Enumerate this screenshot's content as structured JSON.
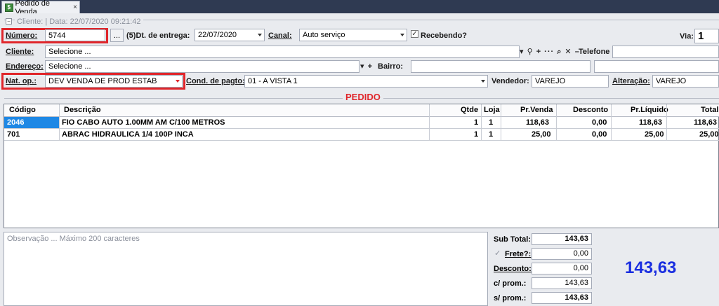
{
  "tab": {
    "label": "Pedido de Venda",
    "close": "×"
  },
  "header": {
    "cliente_group": "Cliente:  | Data: 22/07/2020 09:21:42"
  },
  "form": {
    "numero_label": "Número:",
    "numero_value": "5744",
    "ellipsis": "...",
    "dt_entrega_label": "(5)Dt. de entrega:",
    "dt_entrega_value": "22/07/2020",
    "canal_label": "Canal:",
    "canal_value": "Auto serviço",
    "recebendo_label": "Recebendo?",
    "recebendo_check": "✓",
    "via_label": "Via:",
    "via_value": "1",
    "cliente_label": "Cliente:",
    "cliente_value": "Selecione ...",
    "cliente_icons": "▾ ⚲ + ··· ⌕ ✕ –",
    "telefone_label": "Telefone",
    "endereco_label": "Endereço:",
    "endereco_value": "Selecione ...",
    "endereco_icons": "▾ +",
    "bairro_label": "Bairro:",
    "natop_label": "Nat. op.:",
    "natop_value": "DEV VENDA DE PROD ESTAB",
    "cond_label": "Cond. de pagto:",
    "cond_value": "01 - A VISTA 1",
    "vendedor_label": "Vendedor:",
    "vendedor_value": "VAREJO",
    "alteracao_label": "Alteração:",
    "alteracao_value": "VAREJO"
  },
  "pedido_title": "PEDIDO",
  "grid": {
    "headers": [
      "Código",
      "Descrição",
      "Qtde",
      "Loja",
      "Pr.Venda",
      "Desconto",
      "Pr.Líquido",
      "Total"
    ],
    "rows": [
      [
        "2046",
        "FIO CABO AUTO  1.00MM AM C/100 METROS",
        "1",
        "1",
        "118,63",
        "0,00",
        "118,63",
        "118,63"
      ],
      [
        "701",
        "ABRAC HIDRAULICA 1/4 100P INCA",
        "1",
        "1",
        "25,00",
        "0,00",
        "25,00",
        "25,00"
      ]
    ]
  },
  "obs_placeholder": "Observação ... Máximo 200 caracteres",
  "totals": {
    "subtotal_label": "Sub Total:",
    "subtotal_value": "143,63",
    "frete_label": "Frete?:",
    "frete_check": "✓",
    "frete_value": "0,00",
    "desconto_label": "Desconto:",
    "desconto_value": "0,00",
    "cprom_label": "c/ prom.:",
    "cprom_value": "143,63",
    "sprom_label": "s/ prom.:",
    "sprom_value": "143,63",
    "grand_total": "143,63"
  },
  "colors": {
    "accent_red": "#e0262b",
    "total_blue": "#1a2ee0",
    "selection": "#1e88e5"
  }
}
